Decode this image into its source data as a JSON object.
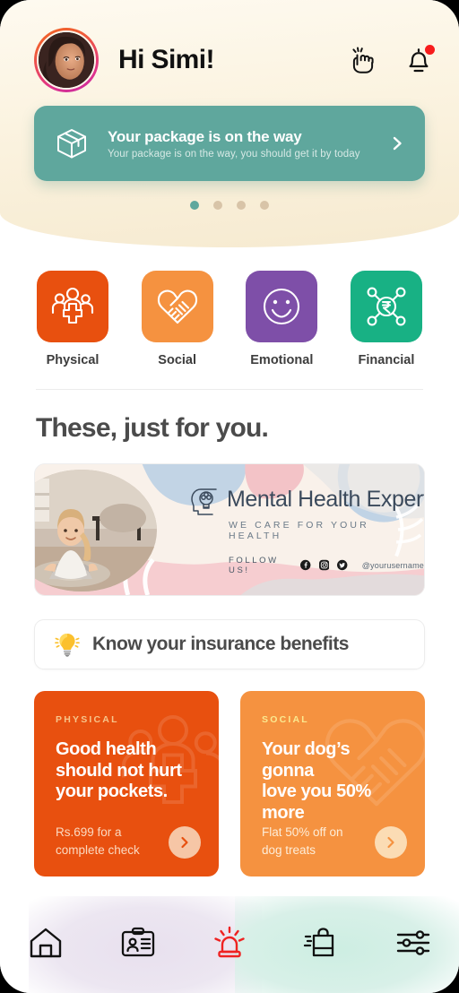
{
  "header": {
    "avatar_name": "avatar",
    "greeting": "Hi Simi!",
    "icons": [
      {
        "name": "snap-fingers-icon",
        "label": "snap-fingers"
      },
      {
        "name": "bell-icon",
        "label": "notifications"
      }
    ],
    "package_card": {
      "icon": "package-box-icon",
      "title": "Your package is on the way",
      "subtitle": "Your package is on the way, you should get it by today",
      "chevron": "chevron-right-icon"
    },
    "carousel": {
      "total": 4,
      "active_index": 0
    }
  },
  "categories": [
    {
      "label": "Physical",
      "icon": "family-health-icon",
      "color": "#e8500f"
    },
    {
      "label": "Social",
      "icon": "handshake-heart-icon",
      "color": "#f59240"
    },
    {
      "label": "Emotional",
      "icon": "smiley-face-icon",
      "color": "#7e4fa8"
    },
    {
      "label": "Financial",
      "icon": "rupee-network-icon",
      "color": "#18b184"
    }
  ],
  "section": {
    "title": "These, just for you."
  },
  "banner": {
    "title": "Mental Health Experts",
    "tagline": "WE CARE FOR YOUR HEALTH",
    "follow_label": "FOLLOW US!",
    "handle": "@yourusername",
    "social_icons": [
      "facebook-icon",
      "instagram-icon",
      "twitter-icon"
    ],
    "logo_icon": "head-lightbulb-icon"
  },
  "insurance": {
    "icon": "lightbulb-icon",
    "label": "Know your insurance benefits"
  },
  "promos": [
    {
      "kicker": "PHYSICAL",
      "headline": "Good health\nshould not hurt\nyour pockets.",
      "description": "Rs.699 for a\ncomplete check",
      "bg_color": "#e8500f",
      "arrow": "chevron-right-icon",
      "watermark": "family-health-icon"
    },
    {
      "kicker": "SOCIAL",
      "headline": "Your dog’s\ngonna\nlove you 50%\nmore",
      "description": "Flat 50% off on\ndog treats",
      "bg_color": "#f59240",
      "arrow": "chevron-right-icon",
      "watermark": "handshake-heart-icon"
    }
  ],
  "bottom_nav": [
    {
      "name": "home",
      "icon": "home-icon",
      "active": false
    },
    {
      "name": "card",
      "icon": "id-card-icon",
      "active": false
    },
    {
      "name": "emergency",
      "icon": "siren-alert-icon",
      "active": true
    },
    {
      "name": "shop",
      "icon": "shopping-bag-icon",
      "active": false
    },
    {
      "name": "settings",
      "icon": "sliders-icon",
      "active": false
    }
  ],
  "colors": {
    "header_bg": "#fbf3e0",
    "teal": "#5fa79d",
    "accent_orange": "#e8500f",
    "accent_light_orange": "#f59240",
    "purple": "#7e4fa8",
    "green": "#18b184",
    "alert_red": "#f71c1c"
  }
}
